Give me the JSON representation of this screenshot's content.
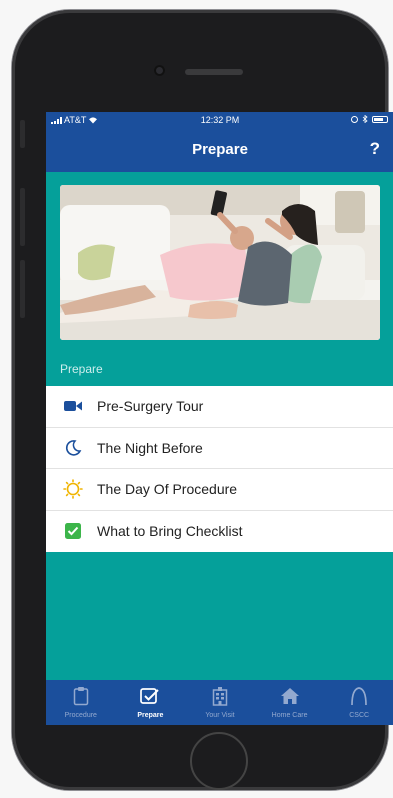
{
  "status_bar": {
    "carrier": "AT&T",
    "time": "12:32 PM"
  },
  "navbar": {
    "title": "Prepare",
    "help_label": "?"
  },
  "hero_image": {
    "alt": "Woman lying on sofa with child, holding a phone"
  },
  "section": {
    "label": "Prepare"
  },
  "menu": {
    "items": [
      {
        "label": "Pre-Surgery Tour",
        "icon": "video-camera-icon",
        "color": "#1b4f9c"
      },
      {
        "label": "The Night Before",
        "icon": "moon-icon",
        "color": "#1b4f9c"
      },
      {
        "label": "The Day Of Procedure",
        "icon": "sun-icon",
        "color": "#f0b400"
      },
      {
        "label": "What to Bring Checklist",
        "icon": "checkbox-icon",
        "color": "#3cb54a"
      }
    ]
  },
  "tabbar": {
    "tabs": [
      {
        "label": "Procedure",
        "icon": "clipboard-icon",
        "active": false
      },
      {
        "label": "Prepare",
        "icon": "checkmark-box-icon",
        "active": true
      },
      {
        "label": "Your Visit",
        "icon": "hospital-icon",
        "active": false
      },
      {
        "label": "Home Care",
        "icon": "house-icon",
        "active": false
      },
      {
        "label": "CSCC",
        "icon": "arch-icon",
        "active": false
      }
    ]
  },
  "colors": {
    "primary": "#1b4f9c",
    "teal": "#05a09a"
  }
}
